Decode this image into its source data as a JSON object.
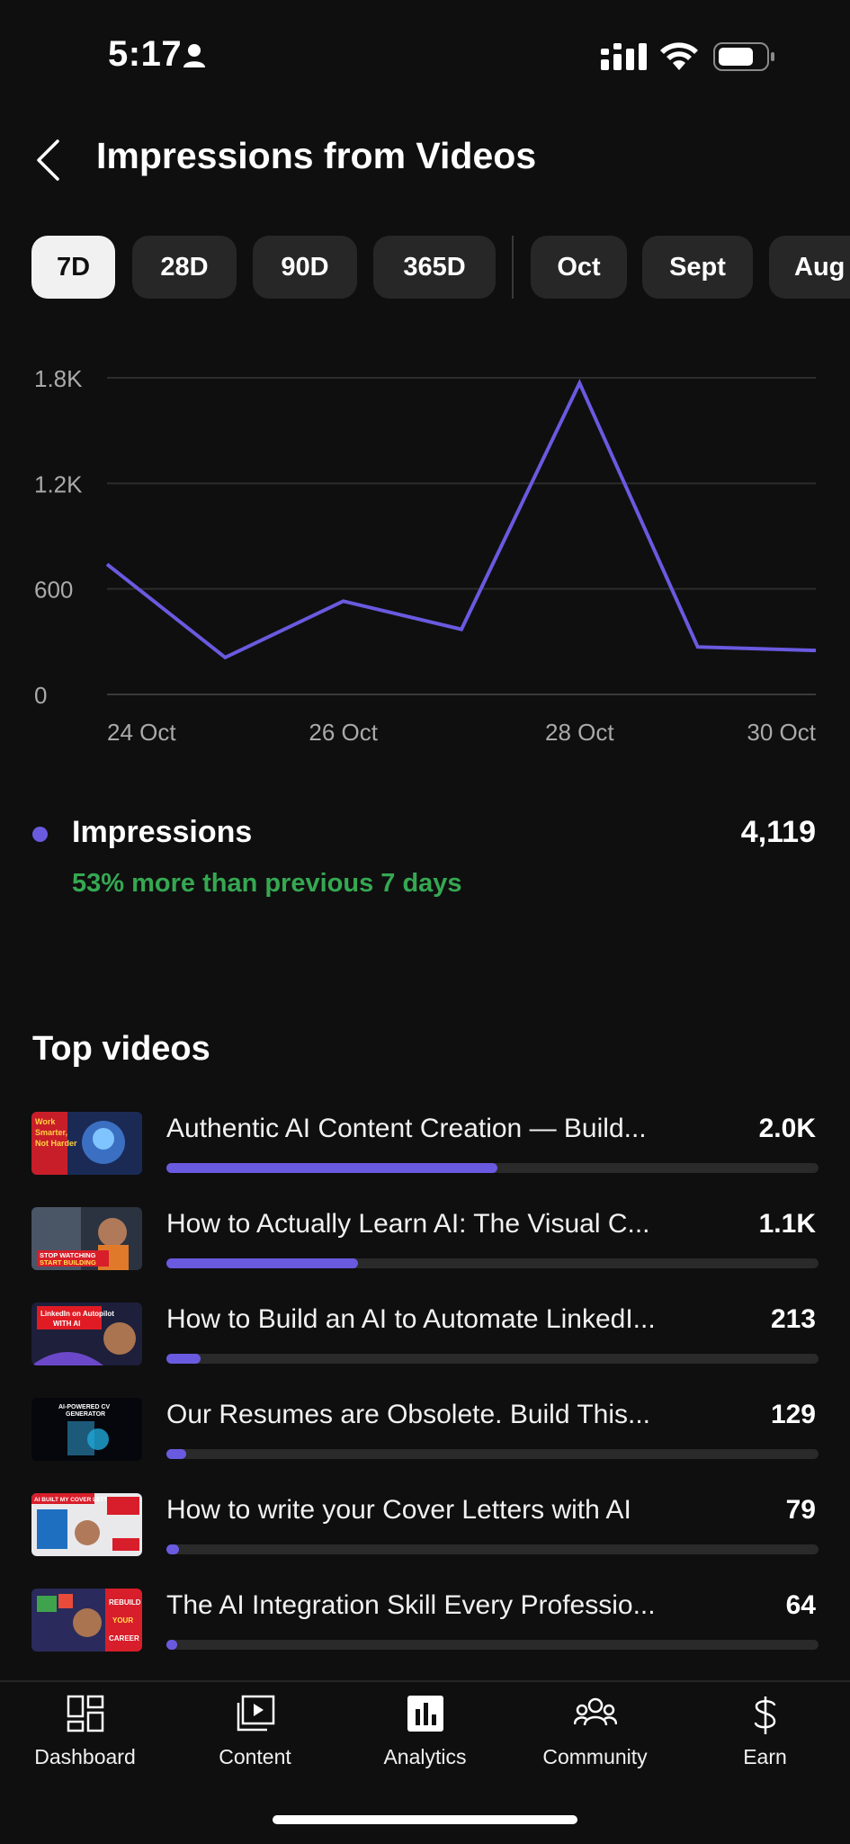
{
  "status_bar": {
    "time": "5:17"
  },
  "header": {
    "title": "Impressions from Videos"
  },
  "range_tabs": [
    {
      "label": "7D",
      "active": true
    },
    {
      "label": "28D",
      "active": false
    },
    {
      "label": "90D",
      "active": false
    },
    {
      "label": "365D",
      "active": false
    },
    {
      "label": "Oct",
      "active": false
    },
    {
      "label": "Sept",
      "active": false
    },
    {
      "label": "Aug",
      "active": false
    }
  ],
  "chart_data": {
    "type": "line",
    "x": [
      "24 Oct",
      "25 Oct",
      "26 Oct",
      "27 Oct",
      "28 Oct",
      "29 Oct",
      "30 Oct"
    ],
    "x_tick_labels": [
      "24 Oct",
      "26 Oct",
      "28 Oct",
      "30 Oct"
    ],
    "series": [
      {
        "name": "Impressions",
        "values": [
          740,
          210,
          530,
          370,
          1770,
          270,
          250
        ],
        "color": "#6a5ae0"
      }
    ],
    "y_ticks": [
      0,
      600,
      1200,
      1800
    ],
    "y_tick_labels": [
      "0",
      "600",
      "1.2K",
      "1.8K"
    ],
    "ylim": [
      0,
      1800
    ],
    "grid": true
  },
  "summary": {
    "label": "Impressions",
    "total": "4,119",
    "change_text": "53% more than previous 7 days",
    "change_color": "#35a852",
    "accent": "#6a5ae0"
  },
  "top_videos": {
    "title": "Top videos",
    "items": [
      {
        "title": "Authentic AI Content Creation — Build...",
        "count": "2.0K",
        "share": 0.508,
        "thumb_text": "Work Smarter, Not Harder"
      },
      {
        "title": "How to Actually Learn AI: The Visual C...",
        "count": "1.1K",
        "share": 0.294,
        "thumb_text": "STOP WATCHING START BUILDING"
      },
      {
        "title": "How to Build an AI to Automate LinkedI...",
        "count": "213",
        "share": 0.052,
        "thumb_text": "LinkedIn on Autopilot WITH AI"
      },
      {
        "title": "Our Resumes are Obsolete. Build This...",
        "count": "129",
        "share": 0.031,
        "thumb_text": "AI-POWERED CV GENERATOR"
      },
      {
        "title": "How to write your Cover Letters with AI",
        "count": "79",
        "share": 0.019,
        "thumb_text": "AI BUILT MY COVER LETTER"
      },
      {
        "title": "The AI Integration Skill Every Professio...",
        "count": "64",
        "share": 0.016,
        "thumb_text": "REBUILD YOUR CAREER"
      }
    ]
  },
  "bottom_nav": [
    {
      "label": "Dashboard",
      "icon": "dashboard-icon"
    },
    {
      "label": "Content",
      "icon": "content-icon"
    },
    {
      "label": "Analytics",
      "icon": "analytics-icon",
      "active": true
    },
    {
      "label": "Community",
      "icon": "community-icon"
    },
    {
      "label": "Earn",
      "icon": "dollar-icon"
    }
  ]
}
